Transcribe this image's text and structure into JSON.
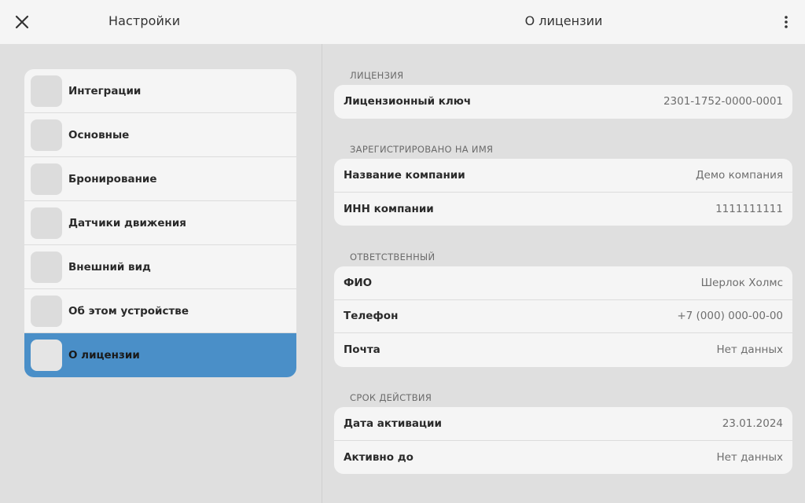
{
  "header": {
    "settings_title": "Настройки",
    "page_title": "О лицензии",
    "close_icon": "close-icon",
    "more_icon": "more-vertical-icon"
  },
  "sidebar": {
    "items": [
      {
        "label": "Интеграции",
        "active": false
      },
      {
        "label": "Основные",
        "active": false
      },
      {
        "label": "Бронирование",
        "active": false
      },
      {
        "label": "Датчики движения",
        "active": false
      },
      {
        "label": "Внешний вид",
        "active": false
      },
      {
        "label": "Об этом устройстве",
        "active": false
      },
      {
        "label": "О лицензии",
        "active": true
      }
    ],
    "accent_color": "#4a8fc8"
  },
  "sections": {
    "license": {
      "title": "ЛИЦЕНЗИЯ",
      "rows": [
        {
          "label": "Лицензионный ключ",
          "value": "2301-1752-0000-0001"
        }
      ]
    },
    "registered": {
      "title": "ЗАРЕГИСТРИРОВАНО НА ИМЯ",
      "rows": [
        {
          "label": "Название компании",
          "value": "Демо компания"
        },
        {
          "label": "ИНН компании",
          "value": "1111111111"
        }
      ]
    },
    "responsible": {
      "title": "ОТВЕТСТВЕННЫЙ",
      "rows": [
        {
          "label": "ФИО",
          "value": "Шерлок Холмс"
        },
        {
          "label": "Телефон",
          "value": "+7 (000) 000-00-00"
        },
        {
          "label": "Почта",
          "value": "Нет данных"
        }
      ]
    },
    "validity": {
      "title": "СРОК ДЕЙСТВИЯ",
      "rows": [
        {
          "label": "Дата активации",
          "value": "23.01.2024"
        },
        {
          "label": "Активно до",
          "value": "Нет данных"
        }
      ]
    }
  }
}
